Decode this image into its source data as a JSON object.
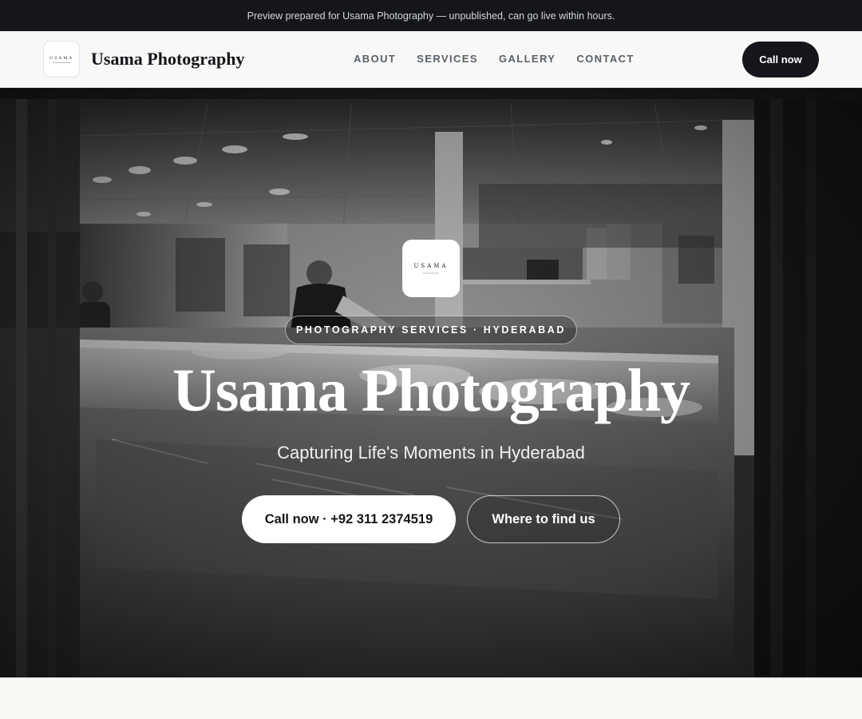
{
  "preview_bar": {
    "text": "Preview prepared for Usama Photography — unpublished, can go live within hours."
  },
  "navbar": {
    "logo_text": "USAMA",
    "brand_name": "Usama Photography",
    "links": [
      "ABOUT",
      "SERVICES",
      "GALLERY",
      "CONTACT"
    ],
    "cta_label": "Call now"
  },
  "hero": {
    "logo_text": "USAMA",
    "badge": "PHOTOGRAPHY SERVICES · HYDERABAD",
    "title": "Usama Photography",
    "subtitle": "Capturing Life's Moments in Hyderabad",
    "primary_button": "Call now · +92 311 2374519",
    "secondary_button": "Where to find us"
  },
  "colors": {
    "dark": "#14161b",
    "light": "#f8f7f4",
    "white": "#ffffff"
  }
}
